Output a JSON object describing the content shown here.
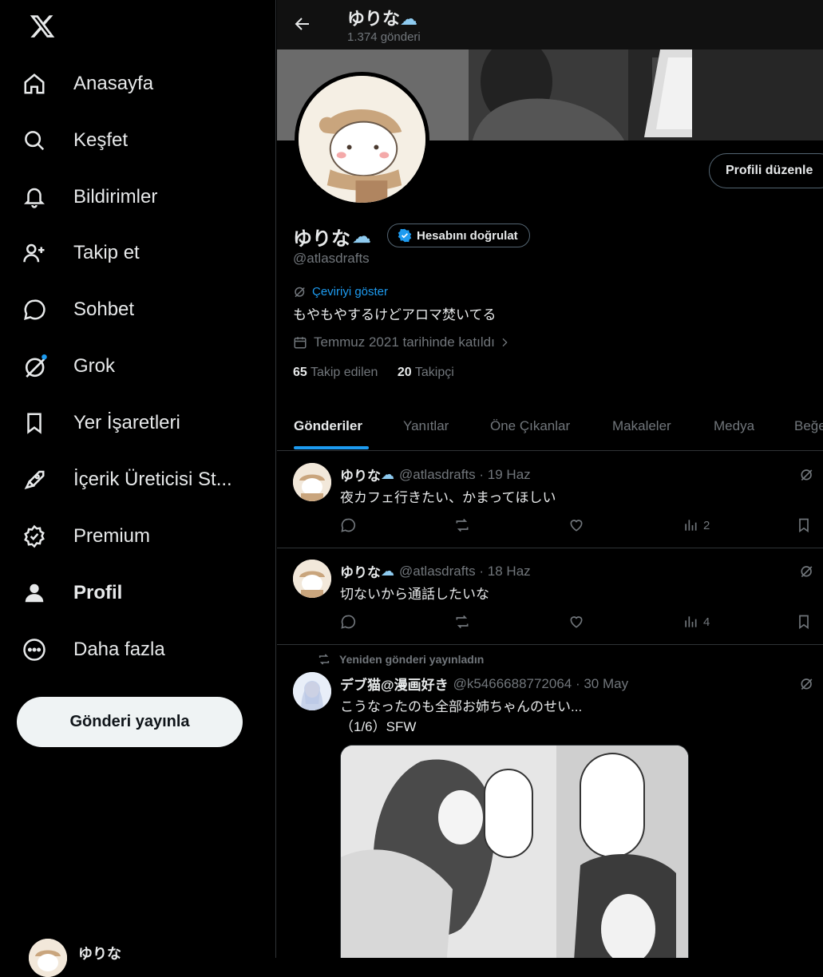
{
  "sidebar": {
    "items": [
      {
        "label": "Anasayfa",
        "icon": "home-icon"
      },
      {
        "label": "Keşfet",
        "icon": "search-icon"
      },
      {
        "label": "Bildirimler",
        "icon": "bell-icon"
      },
      {
        "label": "Takip et",
        "icon": "follow-icon"
      },
      {
        "label": "Sohbet",
        "icon": "chat-icon"
      },
      {
        "label": "Grok",
        "icon": "grok-icon"
      },
      {
        "label": "Yer İşaretleri",
        "icon": "bookmark-icon"
      },
      {
        "label": "İçerik Üreticisi St...",
        "icon": "rocket-icon"
      },
      {
        "label": "Premium",
        "icon": "premium-icon"
      },
      {
        "label": "Profil",
        "icon": "person-icon"
      },
      {
        "label": "Daha fazla",
        "icon": "more-icon"
      }
    ],
    "post_button": "Gönderi yayınla",
    "account_name": "ゆりな"
  },
  "header": {
    "name": "ゆりな",
    "post_count": "1.374 gönderi"
  },
  "profile": {
    "edit_button": "Profili düzenle",
    "name": "ゆりな",
    "verify_button": "Hesabını doğrulat",
    "handle": "@atlasdrafts",
    "translate": "Çeviriyi göster",
    "bio": "もやもやするけどアロマ焚いてる",
    "joined": "Temmuz 2021 tarihinde katıldı",
    "following_count": "65",
    "following_label": "Takip edilen",
    "followers_count": "20",
    "followers_label": "Takipçi"
  },
  "tabs": [
    "Gönderiler",
    "Yanıtlar",
    "Öne Çıkanlar",
    "Makaleler",
    "Medya",
    "Beğeni"
  ],
  "tweets": [
    {
      "name": "ゆりな",
      "meta": "@atlasdrafts · 19 Haz",
      "text": "夜カフェ行きたい、かまってほしい",
      "views": "2"
    },
    {
      "name": "ゆりな",
      "meta": "@atlasdrafts · 18 Haz",
      "text": "切ないから通話したいな",
      "views": "4"
    },
    {
      "retweet_label": "Yeniden gönderi yayınladın",
      "name": "デブ猫@漫画好き",
      "meta": "@k5466688772064 · 30 May",
      "text": "こうなったのも全部お姉ちゃんのせい...",
      "text2": "（1/6）SFW"
    }
  ],
  "colors": {
    "accent": "#1d9bf0",
    "background": "#000000",
    "muted": "#71767b",
    "border": "#2f3336"
  }
}
